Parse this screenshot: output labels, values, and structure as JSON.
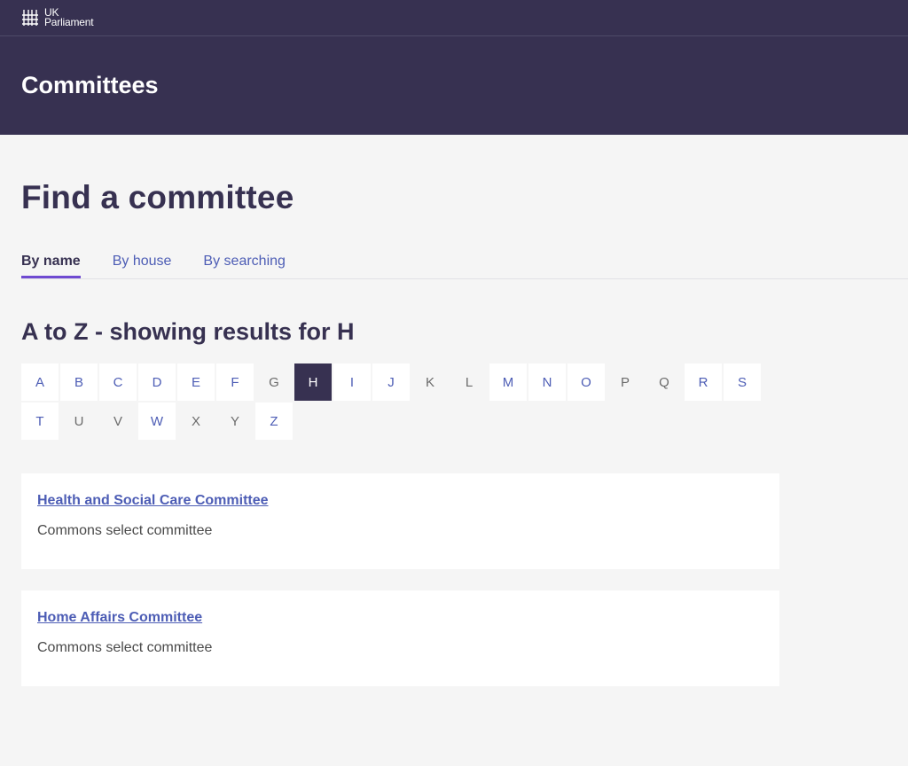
{
  "brand": {
    "line1": "UK",
    "line2": "Parliament",
    "icon": "portcullis-icon"
  },
  "header": {
    "title": "Committees"
  },
  "page": {
    "title": "Find a committee"
  },
  "tabs": [
    {
      "label": "By name",
      "active": true
    },
    {
      "label": "By house",
      "active": false
    },
    {
      "label": "By searching",
      "active": false
    }
  ],
  "az": {
    "heading": "A to Z - showing results for H",
    "selected": "H",
    "letters": [
      {
        "letter": "A",
        "enabled": true
      },
      {
        "letter": "B",
        "enabled": true
      },
      {
        "letter": "C",
        "enabled": true
      },
      {
        "letter": "D",
        "enabled": true
      },
      {
        "letter": "E",
        "enabled": true
      },
      {
        "letter": "F",
        "enabled": true
      },
      {
        "letter": "G",
        "enabled": false
      },
      {
        "letter": "H",
        "enabled": true
      },
      {
        "letter": "I",
        "enabled": true
      },
      {
        "letter": "J",
        "enabled": true
      },
      {
        "letter": "K",
        "enabled": false
      },
      {
        "letter": "L",
        "enabled": false
      },
      {
        "letter": "M",
        "enabled": true
      },
      {
        "letter": "N",
        "enabled": true
      },
      {
        "letter": "O",
        "enabled": true
      },
      {
        "letter": "P",
        "enabled": false
      },
      {
        "letter": "Q",
        "enabled": false
      },
      {
        "letter": "R",
        "enabled": true
      },
      {
        "letter": "S",
        "enabled": true
      },
      {
        "letter": "T",
        "enabled": true
      },
      {
        "letter": "U",
        "enabled": false
      },
      {
        "letter": "V",
        "enabled": false
      },
      {
        "letter": "W",
        "enabled": true
      },
      {
        "letter": "X",
        "enabled": false
      },
      {
        "letter": "Y",
        "enabled": false
      },
      {
        "letter": "Z",
        "enabled": true
      }
    ]
  },
  "results": [
    {
      "title": "Health and Social Care Committee",
      "type": "Commons select committee"
    },
    {
      "title": "Home Affairs Committee",
      "type": "Commons select committee"
    }
  ],
  "colors": {
    "header_bg": "#373151",
    "link": "#4d5db5",
    "active_tab_underline": "#6f4ad1",
    "page_bg": "#f5f5f5"
  }
}
